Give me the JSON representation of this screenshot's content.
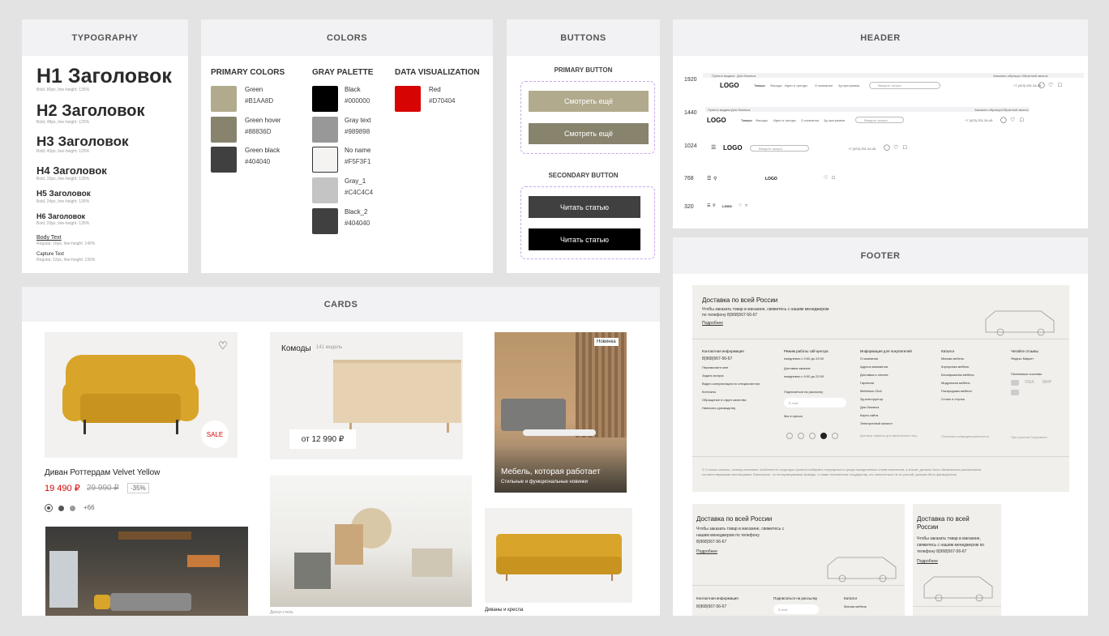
{
  "sections": {
    "typography": "TYPOGRAPHY",
    "colors": "COLORS",
    "buttons": "BUTTONS",
    "header": "HEADER",
    "cards": "CARDS",
    "footer": "FOOTER"
  },
  "typography": [
    {
      "label": "H1 Заголовок",
      "spec": "Bold, 80px, line-height: 135%"
    },
    {
      "label": "H2 Заголовок",
      "spec": "Bold, 48px, line-height: 125%"
    },
    {
      "label": "H3 Заголовок",
      "spec": "Bold, 40px, line-height: 125%"
    },
    {
      "label": "H4 Заголовок",
      "spec": "Bold, 32px, line-height: 135%"
    },
    {
      "label": "H5 Заголовок",
      "spec": "Bold, 24px, line-height: 135%"
    },
    {
      "label": "H6 Заголовок",
      "spec": "Bold, 20px, line-height: 135%"
    },
    {
      "label": "Body Text",
      "spec": "Regular, 16px, line-height: 140%"
    },
    {
      "label": "Capture Text",
      "spec": "Regular, 12px, line-height: 130%"
    }
  ],
  "colors": {
    "primary_title": "PRIMARY COLORS",
    "gray_title": "GRAY PALETTE",
    "data_title": "DATA VISUALIZATION",
    "primary": [
      {
        "name": "Green",
        "hex": "#B1AA8D"
      },
      {
        "name": "Green hover",
        "hex": "#88836D"
      },
      {
        "name": "Green black",
        "hex": "#404040"
      }
    ],
    "gray": [
      {
        "name": "Black",
        "hex": "#000000"
      },
      {
        "name": "Gray text",
        "hex": "#989898"
      },
      {
        "name": "No name",
        "hex": "#F5F3F1"
      },
      {
        "name": "Gray_1",
        "hex": "#C4C4C4"
      },
      {
        "name": "Black_2",
        "hex": "#404040"
      }
    ],
    "data": [
      {
        "name": "Red",
        "hex": "#D70404"
      }
    ]
  },
  "buttons": {
    "primary_title": "PRIMARY BUTTON",
    "secondary_title": "SECONDARY BUTTON",
    "primary_1": "Смотреть ещё",
    "primary_2": "Смотреть ещё",
    "secondary_1": "Читать статью",
    "secondary_2": "Читать статью"
  },
  "header": {
    "logo": "LOGO",
    "search_placeholder": "Введите запрос",
    "phone": "+7 (423) 251-34-45",
    "top_links": [
      "Пункты выдачи",
      "Для бизнеса"
    ],
    "top_right": [
      "Заказать образцы",
      "Обратный звонок"
    ],
    "nav": [
      "Товары",
      "Фасады",
      "Идеи и тренды",
      "О компании",
      "3д программа"
    ],
    "breakpoints": [
      "1920",
      "1440",
      "1024",
      "768",
      "320"
    ]
  },
  "cards": {
    "product_name": "Диван Роттердам Velvet Yellow",
    "price": "19 490 ₽",
    "old_price": "29 990 ₽",
    "discount": "-35%",
    "sale_badge": "SALE",
    "more_colors": "+66",
    "category_title": "Комоды",
    "category_count": "141 модель",
    "category_price": "от 12 990 ₽",
    "promo_badge": "Новинка",
    "promo_title": "Мебель, которая работает",
    "promo_sub": "Стильные и функциональные новинки",
    "sofa_caption": "Диваны и кресла",
    "interior_caption": "Декор-стиль"
  },
  "footer": {
    "delivery_title": "Доставка по всей России",
    "delivery_text_1": "Чтобы заказать товар в магазине, свяжитесь с нашим менеджером",
    "delivery_text_2": "по телефону 8(968)567-56-67",
    "more_link": "Подробнее",
    "contact_title": "Контактная информация",
    "phone": "8(968)567-56-67",
    "contact_links": [
      "Перезвоните мне",
      "Задать вопрос",
      "Видео консультация по специалистом",
      "Контакты",
      "Обращение в отдел качества",
      "Написать руководству"
    ],
    "schedule_title": "Режим работы call-центра",
    "schedule_1": "ежедневно с 9:00 до 22:00",
    "orders_title": "Доставка заказов",
    "schedule_2": "ежедневно с 9:00 до 22:00",
    "subscribe_title": "Подписаться на рассылку",
    "email_placeholder": "E-mail",
    "press": "Мы в прессе",
    "buyers_title": "Информация для покупателей",
    "buyers_links": [
      "О компании",
      "Адреса магазинов",
      "Доставка и оплата",
      "Гарантии",
      "Mebelson.Club",
      "3д-конструктор",
      "Для бизнеса",
      "Карта сайта",
      "Электронный каталог"
    ],
    "catalog_title": "Каталог",
    "catalog_links": [
      "Мягкая мебель",
      "Корпусная мебель",
      "Бескаркасная мебель",
      "Модульная мебель",
      "Распродажа мебели",
      "Столы и стулья"
    ],
    "reviews_title": "Читайте отзывы",
    "reviews_link": "Яндекс Маркет",
    "payments_title": "Платежные системы",
    "payments": [
      "VISA",
      "МИР"
    ],
    "offer": "Договор оферты для физических лиц",
    "privacy": "Политика конфиденциальности",
    "made_by": "При участии Супремати",
    "copyright": "© Столько сказать, почему ключевые особенности структуры проекта набирают популярность среди определенных слоев населения, а значит, должны быть обязательны рассмотрены.",
    "copyright_2": "соответствующими инстанциями. Банальные, но неопровержимые выводы, а также положенные государству, что значительно не из усилий, должны быть функциональ",
    "tablet_title": "Доставка по всей России",
    "tablet_text_1": "Чтобы заказать товар в магазине, свяжитесь с",
    "tablet_text_2": "нашим менеджером по телефону",
    "tablet_text_3": "8(968)567-56-67",
    "tablet_contact": "Контактная информация",
    "tablet_subscribe": "Подписаться на рассылку",
    "tablet_catalog": "Каталог",
    "tablet_catalog_1": "Мягкая мебель",
    "mobile_title_1": "Доставка по всей",
    "mobile_title_2": "России",
    "mobile_text_1": "Чтобы заказать товар в магазине,",
    "mobile_text_2": "свяжитесь с нашим менеджером по",
    "mobile_text_3": "телефону 8(968)567-56-67"
  }
}
